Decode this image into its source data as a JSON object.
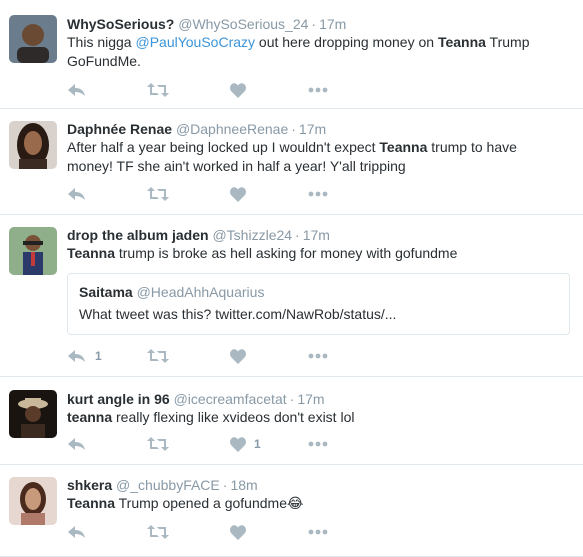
{
  "tweets": [
    {
      "name": "WhySoSerious?",
      "handle": "@WhySoSerious_24",
      "time": "17m",
      "text_parts": [
        "This nigga ",
        "@PaulYouSoCrazy",
        " out here dropping money on ",
        "Teanna",
        " Trump",
        "GoFundMe."
      ],
      "actions": {
        "reply_count": "",
        "retweet_count": "",
        "like_count": ""
      }
    },
    {
      "name": "Daphnée Renae",
      "handle": "@DaphneeRenae",
      "time": "17m",
      "text_parts": [
        "After half a year being locked up I wouldn't expect ",
        "Teanna",
        " trump to have",
        "money! TF she ain't worked in half a year! Y'all tripping"
      ],
      "actions": {
        "reply_count": "",
        "retweet_count": "",
        "like_count": ""
      }
    },
    {
      "name": "drop the album jaden",
      "handle": "@Tshizzle24",
      "time": "17m",
      "text_parts": [
        "Teanna",
        " trump is broke as hell asking for money with gofundme"
      ],
      "quote": {
        "name": "Saitama",
        "handle": "@HeadAhhAquarius",
        "text": "What tweet was this? twitter.com/NawRob/status/..."
      },
      "actions": {
        "reply_count": "1",
        "retweet_count": "",
        "like_count": ""
      }
    },
    {
      "name": "kurt angle in 96",
      "handle": "@icecreamfacetat",
      "time": "17m",
      "text_parts": [
        "teanna",
        " really flexing like xvideos don't exist lol"
      ],
      "actions": {
        "reply_count": "",
        "retweet_count": "",
        "like_count": "1"
      }
    },
    {
      "name": "shkera",
      "handle": "@_chubbyFACE",
      "time": "18m",
      "text_parts": [
        "Teanna",
        " Trump opened a gofundme",
        "😂"
      ],
      "actions": {
        "reply_count": "",
        "retweet_count": "",
        "like_count": ""
      }
    }
  ],
  "separator": "·",
  "colors": {
    "name": "#292f33",
    "meta": "#8899a6",
    "mention": "#3b94d9",
    "action_icon": "#aab8c2",
    "divider": "#e1e8ed"
  },
  "icons": [
    "reply-icon",
    "retweet-icon",
    "like-icon",
    "more-icon"
  ]
}
